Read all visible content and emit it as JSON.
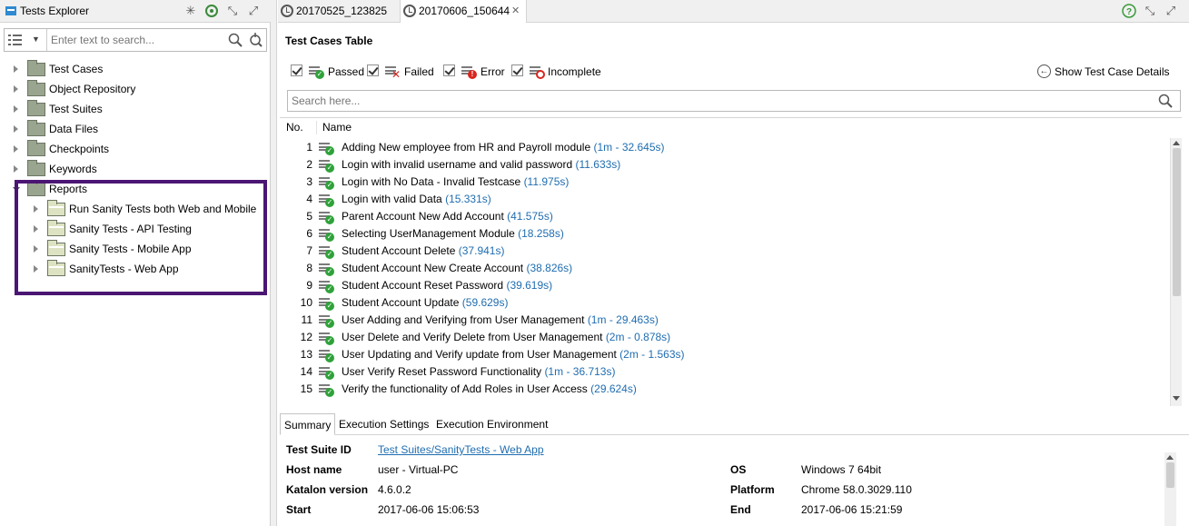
{
  "left_panel": {
    "title": "Tests Explorer",
    "search_placeholder": "Enter text to search...",
    "tree": [
      {
        "label": "Test Cases"
      },
      {
        "label": "Object Repository"
      },
      {
        "label": "Test Suites"
      },
      {
        "label": "Data Files"
      },
      {
        "label": "Checkpoints"
      },
      {
        "label": "Keywords"
      },
      {
        "label": "Reports"
      }
    ],
    "reports": [
      {
        "label": "Run Sanity Tests both Web and Mobile"
      },
      {
        "label": "Sanity Tests - API Testing"
      },
      {
        "label": "Sanity Tests - Mobile App"
      },
      {
        "label": "SanityTests - Web App"
      }
    ]
  },
  "editor_tabs": [
    {
      "label": "20170525_123825"
    },
    {
      "label": "20170606_150644"
    }
  ],
  "test_cases_table": {
    "title": "Test Cases Table",
    "filters": [
      {
        "label": "Passed",
        "checked": true
      },
      {
        "label": "Failed",
        "checked": true
      },
      {
        "label": "Error",
        "checked": true
      },
      {
        "label": "Incomplete",
        "checked": true
      }
    ],
    "show_details_label": "Show Test Case Details",
    "search_placeholder": "Search here...",
    "columns": [
      "No.",
      "Name"
    ],
    "rows": [
      {
        "no": "1",
        "name": "Adding New employee from HR and Payroll module",
        "duration": "(1m - 32.645s)"
      },
      {
        "no": "2",
        "name": "Login with invalid username and valid password",
        "duration": "(11.633s)"
      },
      {
        "no": "3",
        "name": "Login with No Data - Invalid Testcase",
        "duration": "(11.975s)"
      },
      {
        "no": "4",
        "name": "Login with valid Data",
        "duration": "(15.331s)"
      },
      {
        "no": "5",
        "name": "Parent Account New Add Account",
        "duration": "(41.575s)"
      },
      {
        "no": "6",
        "name": "Selecting UserManagement Module",
        "duration": "(18.258s)"
      },
      {
        "no": "7",
        "name": "Student Account Delete",
        "duration": "(37.941s)"
      },
      {
        "no": "8",
        "name": "Student Account New Create Account",
        "duration": "(38.826s)"
      },
      {
        "no": "9",
        "name": "Student Account Reset Password",
        "duration": "(39.619s)"
      },
      {
        "no": "10",
        "name": "Student Account Update",
        "duration": "(59.629s)"
      },
      {
        "no": "11",
        "name": "User Adding and Verifying from User Management",
        "duration": "(1m - 29.463s)"
      },
      {
        "no": "12",
        "name": "User Delete and Verify Delete from User Management",
        "duration": "(2m - 0.878s)"
      },
      {
        "no": "13",
        "name": "User Updating and Verify update from User Management",
        "duration": "(2m - 1.563s)"
      },
      {
        "no": "14",
        "name": "User Verify Reset Password Functionality",
        "duration": "(1m - 36.713s)"
      },
      {
        "no": "15",
        "name": "Verify the functionality of Add Roles in User Access",
        "duration": "(29.624s)"
      }
    ]
  },
  "bottom_tabs": [
    "Summary",
    "Execution Settings",
    "Execution Environment"
  ],
  "summary": {
    "test_suite_id_label": "Test Suite ID",
    "test_suite_id": "Test Suites/SanityTests - Web App",
    "host_name_label": "Host name",
    "host_name": "user - Virtual-PC",
    "os_label": "OS",
    "os": "Windows 7 64bit",
    "katalon_version_label": "Katalon version",
    "katalon_version": "4.6.0.2",
    "platform_label": "Platform",
    "platform": "Chrome 58.0.3029.110",
    "start_label": "Start",
    "start": "2017-06-06 15:06:53",
    "end_label": "End",
    "end": "2017-06-06 15:21:59"
  },
  "colors": {
    "highlight_border": "#4b1673",
    "passed_badge": "#2fa23a",
    "failed_badge": "#d7261e",
    "error_badge": "#d7261e",
    "incomplete_badge": "#d7261e",
    "duration_text": "#1f6db0"
  },
  "icons": [
    "filter-icon",
    "search-icon",
    "link-icon",
    "minimize-icon",
    "maximize-icon",
    "help-icon",
    "close-icon",
    "report-clock-icon",
    "passed-icon",
    "failed-icon",
    "error-icon",
    "incomplete-icon",
    "back-arrow-icon"
  ]
}
